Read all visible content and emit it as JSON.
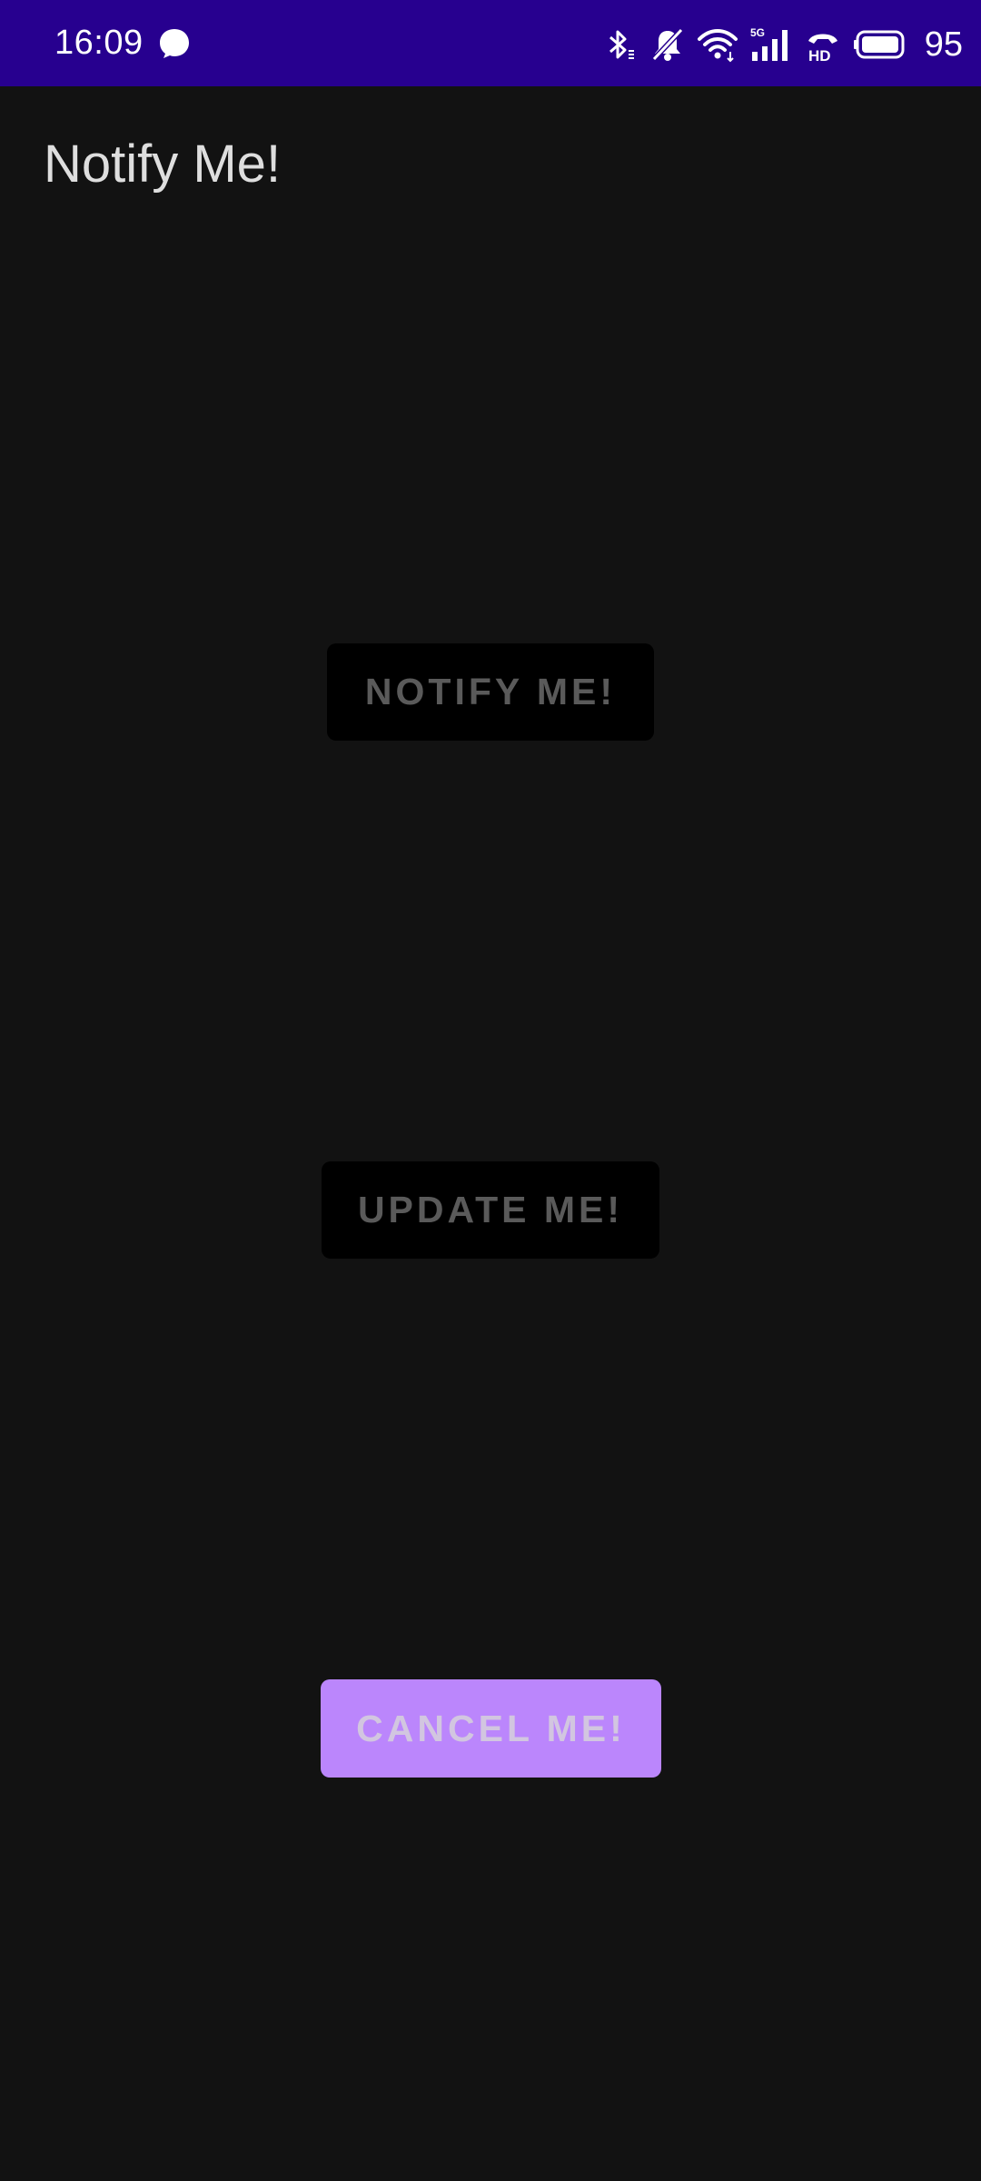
{
  "status_bar": {
    "time": "16:09",
    "battery_level": "95",
    "icons": [
      "chat-bubble-icon",
      "bluetooth-icon",
      "bell-off-icon",
      "wifi-icon",
      "5g-signal-icon",
      "hd-call-icon",
      "battery-icon"
    ],
    "background_color": "#27008f"
  },
  "app_bar": {
    "title": "Notify Me!"
  },
  "buttons": {
    "notify_label": "NOTIFY ME!",
    "update_label": "UPDATE ME!",
    "cancel_label": "CANCEL ME!"
  },
  "colors": {
    "background": "#121212",
    "accent": "#bb86fc",
    "disabled_button": "#000000"
  }
}
